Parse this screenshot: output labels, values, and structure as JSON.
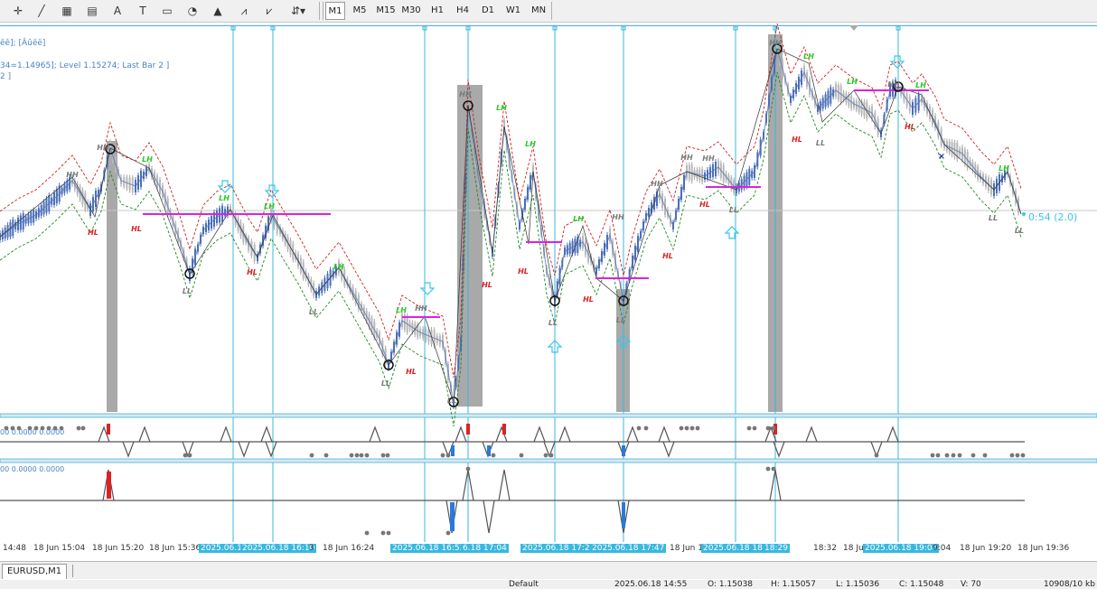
{
  "toolbar": {
    "tools": [
      {
        "icon": "crosshair-icon",
        "glyph": "✛"
      },
      {
        "icon": "line-icon",
        "glyph": "╱"
      },
      {
        "icon": "fibonacci-icon",
        "glyph": "▦"
      },
      {
        "icon": "grid-icon",
        "glyph": "▤"
      },
      {
        "icon": "text-icon",
        "glyph": "A"
      },
      {
        "icon": "text-label-icon",
        "glyph": "T"
      },
      {
        "icon": "rectangle-icon",
        "glyph": "▭"
      },
      {
        "icon": "ellipse-icon",
        "glyph": "◔"
      },
      {
        "icon": "triangle-icon",
        "glyph": "▲"
      },
      {
        "icon": "fibo-fan-icon",
        "glyph": "⩘"
      },
      {
        "icon": "fibo-arcs-icon",
        "glyph": "⩗"
      },
      {
        "icon": "arrows-icon",
        "glyph": "⇵▾"
      }
    ],
    "timeframes": [
      "M1",
      "M5",
      "M15",
      "M30",
      "H1",
      "H4",
      "D1",
      "W1",
      "MN"
    ],
    "active_timeframe": "M1"
  },
  "chart": {
    "info_line_1": "êê];  [Âûêë]",
    "info_line_2": "34=1.14965]; Level 1.15274; Last Bar  2 ]",
    "info_line_3": "2 ]",
    "countdown": "0:54 (2.0)",
    "sub1_label": "00 0.0000 0.0000",
    "sub2_label": "00 0.0000 0.0000",
    "swing_labels": [
      {
        "t": "HH",
        "c": "#7a7a7a"
      },
      {
        "t": "HH",
        "c": "#7a7a7a"
      },
      {
        "t": "LH",
        "c": "#22cc22"
      },
      {
        "t": "LH",
        "c": "#22cc22"
      },
      {
        "t": "LH",
        "c": "#22cc22"
      },
      {
        "t": "HL",
        "c": "#dd2222"
      },
      {
        "t": "HL",
        "c": "#dd2222"
      },
      {
        "t": "HL",
        "c": "#dd2222"
      },
      {
        "t": "LL",
        "c": "#7a7a7a"
      },
      {
        "t": "LL",
        "c": "#7a7a7a"
      },
      {
        "t": "LH",
        "c": "#22cc22"
      },
      {
        "t": "LL",
        "c": "#7a7a7a"
      },
      {
        "t": "LH",
        "c": "#22cc22"
      },
      {
        "t": "HH",
        "c": "#7a7a7a"
      },
      {
        "t": "HL",
        "c": "#dd2222"
      },
      {
        "t": "LL",
        "c": "#7a7a7a"
      },
      {
        "t": "HH",
        "c": "#7a7a7a"
      },
      {
        "t": "LH",
        "c": "#22cc22"
      },
      {
        "t": "LH",
        "c": "#22cc22"
      },
      {
        "t": "HL",
        "c": "#dd2222"
      },
      {
        "t": "HL",
        "c": "#dd2222"
      },
      {
        "t": "LH",
        "c": "#22cc22"
      },
      {
        "t": "HL",
        "c": "#dd2222"
      },
      {
        "t": "LL",
        "c": "#7a7a7a"
      },
      {
        "t": "LL",
        "c": "#7a7a7a"
      },
      {
        "t": "HH",
        "c": "#7a7a7a"
      },
      {
        "t": "HL",
        "c": "#dd2222"
      },
      {
        "t": "HH",
        "c": "#7a7a7a"
      },
      {
        "t": "HH",
        "c": "#7a7a7a"
      },
      {
        "t": "HH",
        "c": "#7a7a7a"
      },
      {
        "t": "HL",
        "c": "#dd2222"
      },
      {
        "t": "LL",
        "c": "#7a7a7a"
      },
      {
        "t": "HH",
        "c": "#7a7a7a"
      },
      {
        "t": "LH",
        "c": "#22cc22"
      },
      {
        "t": "HL",
        "c": "#dd2222"
      },
      {
        "t": "LL",
        "c": "#7a7a7a"
      },
      {
        "t": "LH",
        "c": "#22cc22"
      },
      {
        "t": "HH",
        "c": "#7a7a7a"
      },
      {
        "t": "LH",
        "c": "#22cc22"
      },
      {
        "t": "HL",
        "c": "#dd2222"
      },
      {
        "t": "LH",
        "c": "#22cc22"
      },
      {
        "t": "LL",
        "c": "#7a7a7a"
      },
      {
        "t": "LL",
        "c": "#7a7a7a"
      }
    ]
  },
  "time_axis": [
    {
      "text": "14:48",
      "hl": false
    },
    {
      "text": "18 Jun 15:04",
      "hl": false
    },
    {
      "text": "18 Jun 15:20",
      "hl": false
    },
    {
      "text": "18 Jun 15:36",
      "hl": false
    },
    {
      "text": "2025.06.1",
      "hl": true
    },
    {
      "text": "2025.06.18 16:10",
      "hl": true
    },
    {
      "text": "3",
      "hl": false
    },
    {
      "text": "18 Jun 16:24",
      "hl": false
    },
    {
      "text": "2025.06.18 16:52",
      "hl": true
    },
    {
      "text": "6.18 17:04",
      "hl": true
    },
    {
      "text": "2025.06.18 17:28",
      "hl": true
    },
    {
      "text": "2025.06.18 17:47",
      "hl": true
    },
    {
      "text": "18 Jun 1",
      "hl": false
    },
    {
      "text": "2025.06.18 18:18",
      "hl": true
    },
    {
      "text": "18:29",
      "hl": true
    },
    {
      "text": "18:32",
      "hl": false
    },
    {
      "text": "18 Jun",
      "hl": false
    },
    {
      "text": "2025.06.18 19:03",
      "hl": true
    },
    {
      "text": "9:04",
      "hl": false
    },
    {
      "text": "18 Jun 19:20",
      "hl": false
    },
    {
      "text": "18 Jun 19:36",
      "hl": false
    }
  ],
  "tabs": {
    "active": "EURUSD,M1"
  },
  "status": {
    "profile": "Default",
    "datetime": "2025.06.18 14:55",
    "open": "O: 1.15038",
    "high": "H: 1.15057",
    "low": "L: 1.15036",
    "close": "C: 1.15048",
    "volume": "V: 70",
    "traffic": "10908/10 kb"
  }
}
